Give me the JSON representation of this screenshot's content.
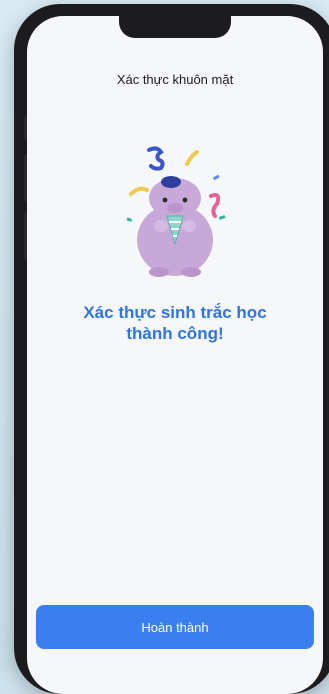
{
  "header": {
    "title": "Xác thực khuôn mặt"
  },
  "main": {
    "illustration_icon": "celebrating-mascot-icon",
    "heading_line1": "Xác thực sinh trắc học",
    "heading_line2": "thành công!"
  },
  "footer": {
    "done_label": "Hoàn thành"
  },
  "colors": {
    "accent": "#2f74e6",
    "button": "#3a7ff0",
    "mascot": "#c7a8d9"
  }
}
